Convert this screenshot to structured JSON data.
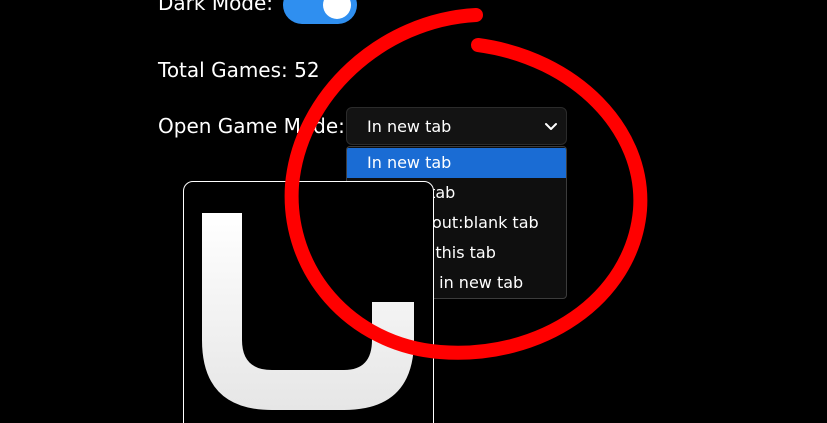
{
  "settings": {
    "dark_mode_label": "Dark Mode:",
    "dark_mode_enabled": true,
    "total_games_label": "Total Games: 52",
    "open_mode_label": "Open Game Mode:",
    "open_mode_selected": "In new tab",
    "open_mode_options": [
      "In new tab",
      "On this tab",
      "In an about:blank tab",
      "Replace this tab",
      "Raw link in new tab"
    ]
  },
  "colors": {
    "background": "#000000",
    "toggle_on": "#2f8ff0",
    "option_highlight": "#1a6cd4",
    "annotation_circle": "#ff0000"
  },
  "icons": {
    "toggle": "toggle-switch-icon",
    "dropdown": "chevron-down-icon",
    "game_logo": "u-letter-logo-icon"
  }
}
